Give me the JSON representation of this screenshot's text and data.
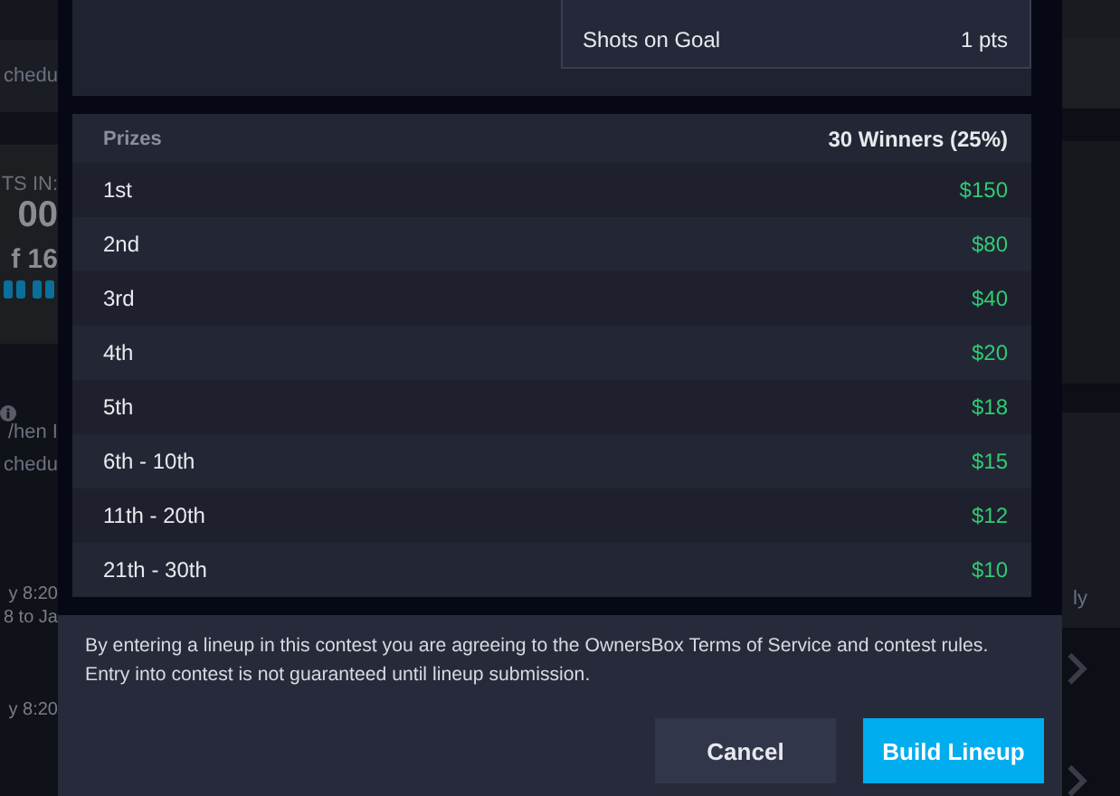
{
  "background": {
    "left": [
      {
        "kind": "row",
        "text": "chedu"
      },
      {
        "kind": "label",
        "text": "TS IN:"
      },
      {
        "kind": "big",
        "text": "00"
      },
      {
        "kind": "medium",
        "text": "f 16"
      },
      {
        "kind": "muted",
        "text": "/hen I"
      },
      {
        "kind": "muted",
        "text": "chedu"
      },
      {
        "kind": "time",
        "text": "y 8:20"
      },
      {
        "kind": "time",
        "text": "8 to Ja"
      },
      {
        "kind": "time",
        "text": "y 8:20"
      }
    ],
    "right": [
      {
        "kind": "muted",
        "text": "ly"
      }
    ]
  },
  "scoring": {
    "rows": [
      {
        "label": "Shots on Goal",
        "value": "1 pts"
      }
    ]
  },
  "prizes": {
    "header": {
      "label": "Prizes",
      "winners": "30 Winners (25%)"
    },
    "rows": [
      {
        "place": "1st",
        "amount": "$150"
      },
      {
        "place": "2nd",
        "amount": "$80"
      },
      {
        "place": "3rd",
        "amount": "$40"
      },
      {
        "place": "4th",
        "amount": "$20"
      },
      {
        "place": "5th",
        "amount": "$18"
      },
      {
        "place": "6th - 10th",
        "amount": "$15"
      },
      {
        "place": "11th - 20th",
        "amount": "$12"
      },
      {
        "place": "21th - 30th",
        "amount": "$10"
      }
    ]
  },
  "notice": "By entering a lineup in this contest you are agreeing to the OwnersBox Terms of Service and contest rules. Entry into contest is not guaranteed until lineup submission.",
  "buttons": [
    {
      "label": "Cancel",
      "kind": "secondary"
    },
    {
      "label": "Build Lineup",
      "kind": "primary"
    }
  ]
}
